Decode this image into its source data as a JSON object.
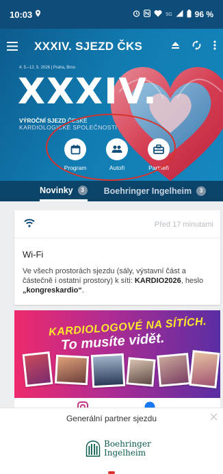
{
  "status_bar": {
    "time": "10:03",
    "signal_label": "5G",
    "battery": "96 %"
  },
  "app_bar": {
    "title": "XXXIV. SJEZD ČKS"
  },
  "hero": {
    "dates": "4. 5.–12. 5. 2026  |  Praha, Brno",
    "big_title": "XXXIV.",
    "subtitle_bold": "VÝROČNÍ SJEZD",
    "subtitle_rest": " ČESKÉ",
    "subtitle_line2": "KARDIOLOGICKÉ SPOLEČNOSTI"
  },
  "quick_actions": [
    {
      "label": "Program",
      "icon": "calendar-icon"
    },
    {
      "label": "Autoři",
      "icon": "people-icon"
    },
    {
      "label": "Partneři",
      "icon": "handshake-icon"
    }
  ],
  "tabs": [
    {
      "label": "Novinky",
      "count": "3"
    },
    {
      "label": "Boehringer Ingelheim",
      "count": "3"
    }
  ],
  "news_card": {
    "time_ago": "Před 17 minutami",
    "title": "Wi-Fi",
    "body_prefix": "Ve všech prostorách sjezdu (sály, výstavní část a částečně i ostatní prostory) k síti: ",
    "network": "KARDIO2026",
    "body_mid": ", heslo ",
    "password": "„kongreskardio“",
    "body_suffix": "."
  },
  "banner": {
    "line1": "KARDIOLOGOVÉ NA SÍTÍCH.",
    "line2": "To musíte vidět."
  },
  "social_icons": [
    "instagram-icon",
    "facebook-icon"
  ],
  "bottom_sheet": {
    "title": "Generální partner sjezdu",
    "logo_line1": "Boehringer",
    "logo_line2": "Ingelheim"
  },
  "colors": {
    "primary": "#0e4d7a",
    "tab_bar": "#0b4369",
    "highlight_ellipse": "#d9312b",
    "banner_yellow": "#ffe92a",
    "logo_green": "#0b5a4f"
  }
}
